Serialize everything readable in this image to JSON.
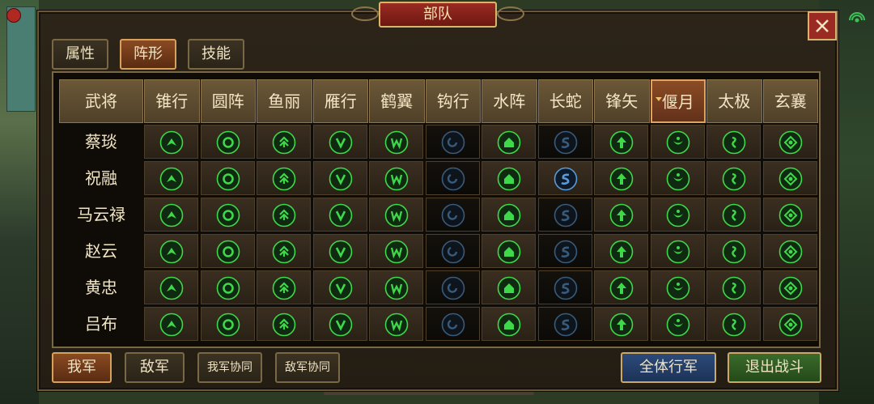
{
  "title": "部队",
  "tabs": [
    {
      "label": "属性",
      "active": false
    },
    {
      "label": "阵形",
      "active": true
    },
    {
      "label": "技能",
      "active": false
    }
  ],
  "header_general": "武将",
  "formations": [
    "锥行",
    "圆阵",
    "鱼丽",
    "雁行",
    "鹤翼",
    "钩行",
    "水阵",
    "长蛇",
    "锋矢",
    "偃月",
    "太极",
    "玄襄"
  ],
  "selected_formation_index": 9,
  "formation_icons": [
    "chevron-up-icon",
    "ring-icon",
    "double-chevron-up-icon",
    "v-icon",
    "w-icon",
    "hook-icon",
    "house-icon",
    "s-snake-icon",
    "arrow-up-icon",
    "crescent-icon",
    "taiji-icon",
    "diamond-icon"
  ],
  "generals": [
    {
      "name": "蔡琰",
      "locked": [
        5,
        7
      ]
    },
    {
      "name": "祝融",
      "locked": [
        5
      ]
    },
    {
      "name": "马云禄",
      "locked": [
        5,
        7
      ]
    },
    {
      "name": "赵云",
      "locked": [
        5,
        7
      ]
    },
    {
      "name": "黄忠",
      "locked": [
        5,
        7
      ]
    },
    {
      "name": "吕布",
      "locked": [
        5,
        7
      ]
    }
  ],
  "buttons": {
    "our_army": "我军",
    "enemy_army": "敌军",
    "our_coop": "我军协同",
    "enemy_coop": "敌军协同",
    "all_march": "全体行军",
    "exit_battle": "退出战斗"
  },
  "colors": {
    "icon_green": "#3fd84a",
    "icon_blue": "#5a9ad8",
    "accent_red": "#9b2a22"
  }
}
